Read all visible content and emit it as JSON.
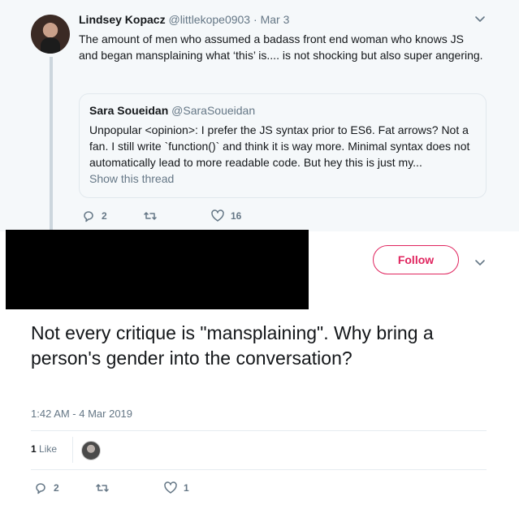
{
  "parent_tweet": {
    "name": "Lindsey Kopacz",
    "handle": "@littlekope0903",
    "separator": "·",
    "date": "Mar 3",
    "text": "The amount of men who assumed a badass front end woman who knows JS and began mansplaining what ‘this’ is.... is not shocking but also super angering.",
    "quote": {
      "name": "Sara Soueidan",
      "handle": "@SaraSoueidan",
      "text": "Unpopular <opinion>: I prefer the JS syntax prior to ES6. Fat arrows? Not a fan. I still write `function()` and think it is way more. Minimal syntax does not automatically lead to more readable code. But hey this is just my...",
      "show_thread": "Show this thread"
    },
    "actions": {
      "replies": "2",
      "retweets": "",
      "likes": "16"
    }
  },
  "reply_tweet": {
    "follow_label": "Follow",
    "text": "Not every critique is \"mansplaining\". Why bring a person's gender into the conversation?",
    "timestamp": "1:42 AM - 4 Mar 2019",
    "like_count": "1",
    "like_label": "Like",
    "actions": {
      "replies": "2",
      "retweets": "",
      "likes": "1"
    }
  },
  "colors": {
    "accent": "#e0245e",
    "muted": "#657786",
    "background_top": "#f5f8fa"
  },
  "icons": [
    "reply-icon",
    "retweet-icon",
    "like-icon",
    "chevron-down-icon"
  ]
}
